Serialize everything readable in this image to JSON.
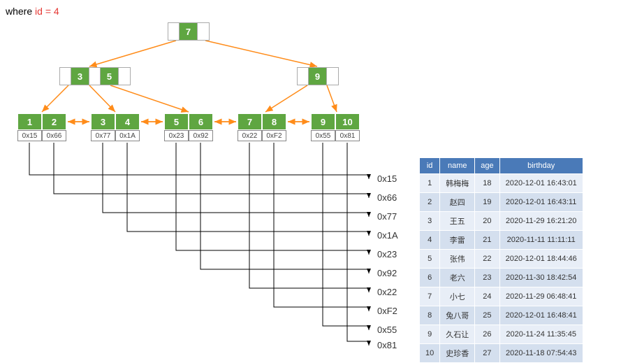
{
  "query": {
    "where": "where ",
    "id": "id",
    "eq": " = 4"
  },
  "tree": {
    "root": {
      "keys": [
        "7"
      ]
    },
    "internal": [
      {
        "keys": [
          "3",
          "5"
        ]
      },
      {
        "keys": [
          "9"
        ]
      }
    ],
    "leaves": [
      {
        "keys": [
          "1",
          "2"
        ],
        "ptrs": [
          "0x15",
          "0x66"
        ]
      },
      {
        "keys": [
          "3",
          "4"
        ],
        "ptrs": [
          "0x77",
          "0x1A"
        ]
      },
      {
        "keys": [
          "5",
          "6"
        ],
        "ptrs": [
          "0x23",
          "0x92"
        ]
      },
      {
        "keys": [
          "7",
          "8"
        ],
        "ptrs": [
          "0x22",
          "0xF2"
        ]
      },
      {
        "keys": [
          "9",
          "10"
        ],
        "ptrs": [
          "0x55",
          "0x81"
        ]
      }
    ]
  },
  "addresses": [
    "0x15",
    "0x66",
    "0x77",
    "0x1A",
    "0x23",
    "0x92",
    "0x22",
    "0xF2",
    "0x55",
    "0x81"
  ],
  "table": {
    "headers": [
      "id",
      "name",
      "age",
      "birthday"
    ],
    "rows": [
      [
        "1",
        "韩梅梅",
        "18",
        "2020-12-01 16:43:01"
      ],
      [
        "2",
        "赵四",
        "19",
        "2020-12-01 16:43:11"
      ],
      [
        "3",
        "王五",
        "20",
        "2020-11-29 16:21:20"
      ],
      [
        "4",
        "李雷",
        "21",
        "2020-11-11 11:11:11"
      ],
      [
        "5",
        "张伟",
        "22",
        "2020-12-01 18:44:46"
      ],
      [
        "6",
        "老六",
        "23",
        "2020-11-30 18:42:54"
      ],
      [
        "7",
        "小七",
        "24",
        "2020-11-29 06:48:41"
      ],
      [
        "8",
        "兔八哥",
        "25",
        "2020-12-01 16:48:41"
      ],
      [
        "9",
        "久石让",
        "26",
        "2020-11-24 11:35:45"
      ],
      [
        "10",
        "史珍香",
        "27",
        "2020-11-18 07:54:43"
      ]
    ]
  },
  "chart_data": {
    "type": "diagram",
    "description": "B+ tree index structure with root key 7, internal nodes [3,5] and [9], five leaf nodes containing keys 1-10 with hex pointer addresses, each pointer mapping to a row in a 10-row data table (id, name, age, birthday).",
    "root_keys": [
      7
    ],
    "internal_keys": [
      [
        3,
        5
      ],
      [
        9
      ]
    ],
    "leaf_entries": [
      {
        "key": 1,
        "ptr": "0x15"
      },
      {
        "key": 2,
        "ptr": "0x66"
      },
      {
        "key": 3,
        "ptr": "0x77"
      },
      {
        "key": 4,
        "ptr": "0x1A"
      },
      {
        "key": 5,
        "ptr": "0x23"
      },
      {
        "key": 6,
        "ptr": "0x92"
      },
      {
        "key": 7,
        "ptr": "0x22"
      },
      {
        "key": 8,
        "ptr": "0xF2"
      },
      {
        "key": 9,
        "ptr": "0x55"
      },
      {
        "key": 10,
        "ptr": "0x81"
      }
    ]
  }
}
